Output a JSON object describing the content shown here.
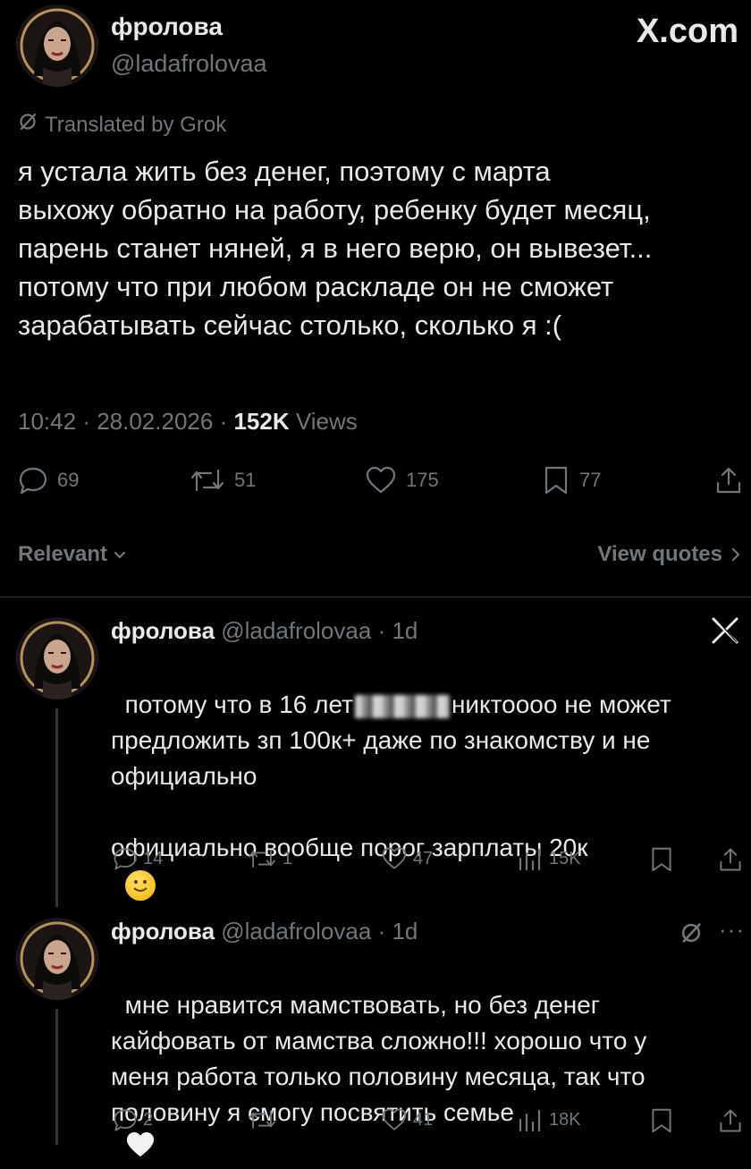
{
  "header": {
    "display_name": "фролова",
    "handle": "@ladafrolovaa",
    "brand": "X.com",
    "translated_label": "Translated by Grok"
  },
  "main_post": {
    "text": "я устала жить без денег, поэтому с марта\nвыхожу обратно на работу, ребенку будет месяц,\nпарень станет няней, я в него верю, он вывезет...\nпотому что при любом раскладе он не сможет\nзарабатывать сейчас столько, сколько я :(",
    "time": "10:42",
    "date": "28.02.2026",
    "views_count": "152K",
    "views_label": "Views",
    "actions": {
      "replies": "69",
      "reposts": "51",
      "likes": "175",
      "bookmarks": "77"
    }
  },
  "sort_bar": {
    "relevant_label": "Relevant",
    "view_quotes_label": "View quotes"
  },
  "replies": [
    {
      "display_name": "фролова",
      "handle": "@ladafrolovaa",
      "age": "1d",
      "text_before": "потому что в 16 лет",
      "text_after": "никтоооо не может\nпредложить зп 100к+ даже по знакомству и не\nофициально\n\nофициально вообще порог зарплаты 20к",
      "actions": {
        "replies": "14",
        "reposts": "1",
        "likes": "47",
        "views": "15K"
      }
    },
    {
      "display_name": "фролова",
      "handle": "@ladafrolovaa",
      "age": "1d",
      "text": "мне нравится мамствовать, но без денег\nкайфовать от мамства сложно!!! хорошо что у\nменя работа только половину месяца, так что\nполовину я смогу посвятить семье",
      "actions": {
        "replies": "2",
        "reposts": "",
        "likes": "41",
        "views": "18K"
      }
    }
  ],
  "colors": {
    "background": "#000000",
    "text": "#e7e9ea",
    "secondary": "#71767b",
    "divider": "#2f3336"
  }
}
